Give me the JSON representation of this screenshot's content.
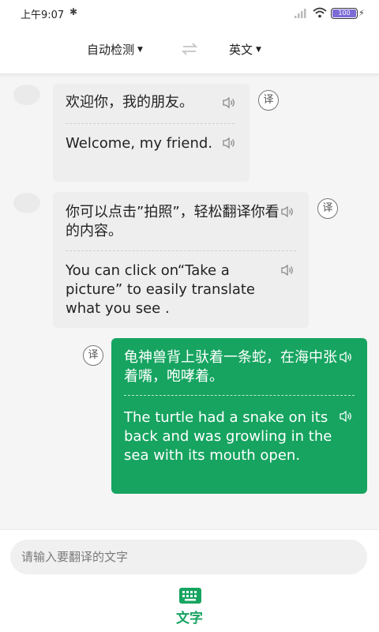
{
  "status_bar": {
    "time": "上午9:07",
    "battery_level": "100"
  },
  "language_bar": {
    "source_language": "自动检测",
    "target_language": "英文"
  },
  "messages": [
    {
      "direction": "incoming",
      "original": "欢迎你，我的朋友。",
      "translation": "Welcome, my friend.",
      "translate_button": "译"
    },
    {
      "direction": "incoming",
      "original": "你可以点击”拍照”，轻松翻译你看的内容。",
      "translation": "You can click on“Take a picture” to easily translate what you see .",
      "translate_button": "译"
    },
    {
      "direction": "outgoing",
      "original": "龟神兽背上驮着一条蛇，在海中张着嘴，咆哮着。",
      "translation": "The turtle had a snake on its back and was growling in the sea with its mouth open.",
      "translate_button": "译"
    }
  ],
  "input": {
    "placeholder": "请输入要翻译的文字"
  },
  "bottom_tab": {
    "label": "文字",
    "icon": "keyboard-icon"
  },
  "colors": {
    "accent_green": "#16a460",
    "incoming_bubble": "#eeeeee",
    "battery_purple": "#7d6bd6"
  }
}
